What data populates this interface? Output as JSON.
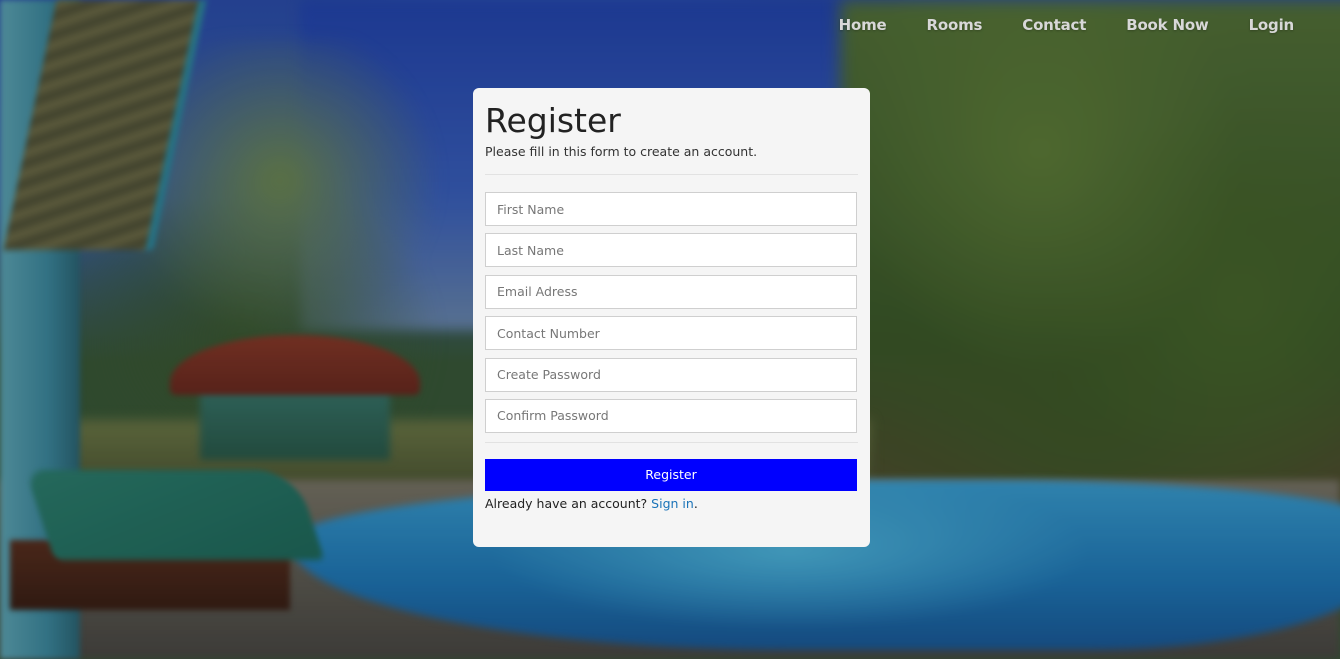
{
  "nav": {
    "items": [
      {
        "label": "Home"
      },
      {
        "label": "Rooms"
      },
      {
        "label": "Contact"
      },
      {
        "label": "Book Now"
      },
      {
        "label": "Login"
      }
    ]
  },
  "form": {
    "title": "Register",
    "subtitle": "Please fill in this form to create an account.",
    "fields": {
      "first_name": {
        "placeholder": "First Name",
        "value": ""
      },
      "last_name": {
        "placeholder": "Last Name",
        "value": ""
      },
      "email": {
        "placeholder": "Email Adress",
        "value": ""
      },
      "contact_number": {
        "placeholder": "Contact Number",
        "value": ""
      },
      "create_password": {
        "placeholder": "Create Password",
        "value": ""
      },
      "confirm_password": {
        "placeholder": "Confirm Password",
        "value": ""
      }
    },
    "submit_label": "Register",
    "signin_prompt": "Already have an account?",
    "signin_link": "Sign in",
    "signin_suffix": "."
  },
  "colors": {
    "accent": "#0000ff",
    "link": "#1a73b8",
    "card_bg": "#f5f5f5"
  }
}
